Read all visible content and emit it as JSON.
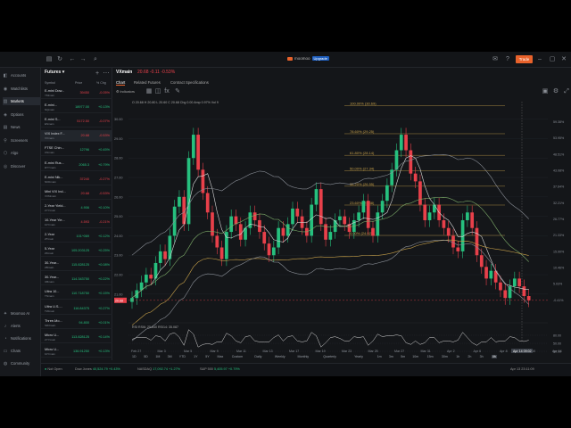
{
  "topbar": {
    "brand": "moomoo",
    "brand_tag": "Upgrade",
    "trade_label": "Trade"
  },
  "nav": {
    "items": [
      {
        "label": "Accounts",
        "icon": "wallet-icon"
      },
      {
        "label": "Watchlists",
        "icon": "eye-icon"
      },
      {
        "label": "Markets",
        "icon": "chart-icon"
      },
      {
        "label": "Options",
        "icon": "options-icon"
      },
      {
        "label": "News",
        "icon": "news-icon"
      },
      {
        "label": "Screeners",
        "icon": "filter-icon"
      },
      {
        "label": "Algo",
        "icon": "algo-icon"
      },
      {
        "label": "Discover",
        "icon": "compass-icon"
      }
    ],
    "bottom": [
      {
        "label": "Moomoo AI",
        "icon": "ai-icon"
      },
      {
        "label": "Alerts",
        "icon": "bell-icon"
      },
      {
        "label": "Notifications",
        "icon": "notify-icon"
      },
      {
        "label": "Chats",
        "icon": "chat-icon"
      },
      {
        "label": "Community",
        "icon": "community-icon"
      }
    ]
  },
  "watchlist": {
    "title": "Futures",
    "headers": {
      "symbol": "Symbol",
      "price": "Price",
      "chg": "% Chg"
    },
    "rows": [
      {
        "sym": "E-mini Dow...",
        "sub": "YMmain",
        "price": "39450",
        "chg": "-0.05%",
        "dir": "dn"
      },
      {
        "sym": "E-mini...",
        "sub": "NQmain",
        "price": "18977.00",
        "chg": "+0.13%",
        "dir": "up"
      },
      {
        "sym": "E-mini S...",
        "sub": "ESmain",
        "price": "5172.50",
        "chg": "-0.07%",
        "dir": "dn"
      },
      {
        "sym": "VIX Index F...",
        "sub": "VXmain",
        "price": "20.68",
        "chg": "-0.53%",
        "dir": "dn"
      },
      {
        "sym": "FTSE Chin...",
        "sub": "CNmain",
        "price": "12796",
        "chg": "+0.45%",
        "dir": "up"
      },
      {
        "sym": "E-mini Rus...",
        "sub": "RTYmain",
        "price": "2065.3",
        "chg": "+0.79%",
        "dir": "up"
      },
      {
        "sym": "E-mini Nik...",
        "sub": "NKDmain",
        "price": "37240",
        "chg": "-0.27%",
        "dir": "dn"
      },
      {
        "sym": "Mini VIX Ind...",
        "sub": "VXMmain",
        "price": "20.68",
        "chg": "-0.53%",
        "dir": "dn"
      },
      {
        "sym": "2-Year Yield...",
        "sub": "2YYmain",
        "price": "4.906",
        "chg": "+0.10%",
        "dir": "up"
      },
      {
        "sym": "10-Year Yie...",
        "sub": "10Ymain",
        "price": "4.593",
        "chg": "-0.21%",
        "dir": "dn"
      },
      {
        "sym": "2-Year",
        "sub": "ZTmain",
        "price": "101^069",
        "chg": "+0.12%",
        "dir": "up"
      },
      {
        "sym": "5-Year",
        "sub": "ZFmain",
        "price": "105.203125",
        "chg": "+0.25%",
        "dir": "up"
      },
      {
        "sym": "30-Year...",
        "sub": "ZBmain",
        "price": "115.828125",
        "chg": "+0.08%",
        "dir": "up"
      },
      {
        "sym": "30-Year...",
        "sub": "UBmain",
        "price": "114.343750",
        "chg": "+0.22%",
        "dir": "up"
      },
      {
        "sym": "Ultra 10...",
        "sub": "TNmain",
        "price": "110.718750",
        "chg": "+0.15%",
        "dir": "up"
      },
      {
        "sym": "Ultra U.S....",
        "sub": "TWmain",
        "price": "116.84375",
        "chg": "+0.27%",
        "dir": "up"
      },
      {
        "sym": "Three-Mo...",
        "sub": "SR3main",
        "price": "94.800",
        "chg": "+0.01%",
        "dir": "up"
      },
      {
        "sym": "Micro U...",
        "sub": "2YYmain",
        "price": "113.828125",
        "chg": "+0.14%",
        "dir": "up"
      },
      {
        "sym": "Micro U...",
        "sub": "10Ymain",
        "price": "136.91250",
        "chg": "+0.13%",
        "dir": "up"
      }
    ]
  },
  "main": {
    "symbol": "VXmain",
    "price_line": "20.68 -0.11 -0.53%",
    "tabs": [
      "Chart",
      "Related Futures",
      "Contract Specifications"
    ],
    "indicators_label": "Indicators",
    "ohlc_label": "O 20.68  H 20.80  L 20.60  C 20.68  Chg 0.00  Amp 0.97%  Vol 9",
    "rsi_label": "RSI  RSI6: 25.640  RSI14: 35.087",
    "slowkd_label": "SLOWKD  K: 16.680  D: 18.401"
  },
  "fib_levels": [
    {
      "label": "100.00% (30.69)",
      "price": 30.69
    },
    {
      "label": "78.60% (29.25)",
      "price": 29.25
    },
    {
      "label": "61.80% (28.14)",
      "price": 28.14
    },
    {
      "label": "50.00% (27.34)",
      "price": 27.34
    },
    {
      "label": "38.20% (26.55)",
      "price": 26.55
    },
    {
      "label": "23.60% (25.58)",
      "price": 25.58
    },
    {
      "label": "0.00% (24.02)",
      "price": 24.02
    }
  ],
  "chart_data": {
    "type": "candlestick",
    "price_ticks": [
      "30.00",
      "29.00",
      "28.00",
      "27.00",
      "26.00",
      "25.00",
      "24.00",
      "23.00",
      "22.00",
      "21.00"
    ],
    "right_ticks": [
      "59.38%",
      "53.95%",
      "48.51%",
      "43.08%",
      "37.64%",
      "32.21%",
      "26.77%",
      "21.33%",
      "15.90%",
      "10.46%",
      "5.03%",
      "-0.41%"
    ],
    "x_labels": [
      "Feb 27",
      "Mar 3",
      "Mar 5",
      "Mar 9",
      "Mar 11",
      "Mar 13",
      "Mar 17",
      "Mar 19",
      "Mar 23",
      "Mar 25",
      "Mar 27",
      "Mar 31",
      "Apr 2",
      "Apr 6",
      "Apr 8",
      "Apr 10",
      "Apr 14"
    ],
    "current_price": "20.68",
    "crosshair_label": "Apr 14 09:02",
    "ylim": [
      19.8,
      30.9
    ],
    "rsi_ticks": [
      "80.00",
      "50.00",
      "20.00"
    ],
    "kd_ticks": [
      "80.00",
      "50.00",
      "20.00"
    ],
    "closes": [
      20.8,
      21.2,
      21.6,
      22.0,
      21.8,
      22.6,
      23.2,
      22.8,
      24.0,
      25.5,
      26.0,
      24.6,
      28.0,
      29.2,
      27.4,
      26.2,
      25.2,
      24.0,
      23.4,
      22.8,
      24.2,
      25.0,
      24.6,
      23.8,
      24.4,
      25.2,
      24.8,
      24.2,
      23.6,
      23.0,
      23.4,
      24.4,
      24.0,
      24.6,
      25.4,
      25.0,
      24.4,
      24.0,
      25.6,
      26.4,
      24.6,
      23.8,
      24.2,
      24.8,
      25.0,
      24.6,
      24.2,
      24.8,
      25.2,
      25.8,
      24.4,
      24.0,
      25.2,
      25.8,
      26.6,
      27.4,
      28.4,
      29.2,
      28.4,
      27.2,
      26.8,
      25.6,
      24.8,
      25.2,
      25.6,
      24.8,
      24.4,
      24.0,
      23.4,
      23.2,
      24.8,
      25.2,
      24.4,
      23.0,
      22.4,
      21.8,
      22.2,
      21.6,
      21.2,
      20.8,
      21.4,
      21.8,
      21.4,
      20.9,
      20.68
    ]
  },
  "timeframes": [
    "1D",
    "5D",
    "1M",
    "3M",
    "YTD",
    "1Y",
    "5Y",
    "Max",
    "Custom",
    "Daily",
    "Weekly",
    "Monthly",
    "Quarterly",
    "Yearly",
    "1m",
    "3m",
    "5m",
    "10m",
    "15m",
    "30m",
    "1h",
    "2h",
    "3h",
    "4h"
  ],
  "status": {
    "market": "Not Open",
    "indices": [
      {
        "name": "Dow Jones",
        "value": "40,524.79",
        "chg": "+0.43%",
        "dir": "up"
      },
      {
        "name": "NASDAQ",
        "value": "17,092.74",
        "chg": "+1.27%",
        "dir": "up"
      },
      {
        "name": "S&P 500",
        "value": "5,405.97",
        "chg": "+0.79%",
        "dir": "up"
      }
    ],
    "time": "Apr 13 23:11:09"
  },
  "colors": {
    "up": "#26c07e",
    "down": "#e8404a",
    "accent": "#e8622b",
    "fib": "#c9a24a"
  }
}
